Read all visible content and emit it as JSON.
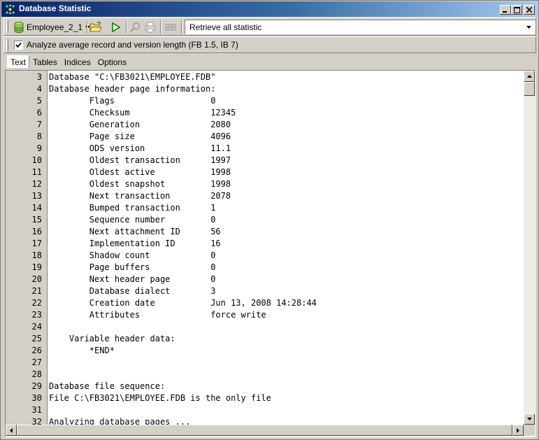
{
  "window": {
    "title": "Database Statistic",
    "controls": [
      "minimize",
      "maximize",
      "close"
    ]
  },
  "toolbar": {
    "database_label": "Employee_2_1",
    "buttons": [
      {
        "name": "open-folder",
        "icon": "folder-open-icon"
      },
      {
        "name": "run",
        "icon": "play-icon"
      },
      {
        "name": "find",
        "icon": "search-icon"
      },
      {
        "name": "print",
        "icon": "printer-icon"
      },
      {
        "name": "options",
        "icon": "grid-icon"
      }
    ],
    "mode": "Retrieve all statistic"
  },
  "options": {
    "analyze_checked": true,
    "analyze_label": "Analyze average record and version length (FB 1.5, IB 7)"
  },
  "tabs": [
    {
      "label": "Text",
      "active": true
    },
    {
      "label": "Tables",
      "active": false
    },
    {
      "label": "Indices",
      "active": false
    },
    {
      "label": "Options",
      "active": false
    }
  ],
  "editor": {
    "lines": [
      {
        "num": "3",
        "text": "Database \"C:\\FB3021\\EMPLOYEE.FDB\""
      },
      {
        "num": "4",
        "text": "Database header page information:"
      },
      {
        "num": "5",
        "text": "        Flags                   0"
      },
      {
        "num": "6",
        "text": "        Checksum                12345"
      },
      {
        "num": "7",
        "text": "        Generation              2080"
      },
      {
        "num": "8",
        "text": "        Page size               4096"
      },
      {
        "num": "9",
        "text": "        ODS version             11.1"
      },
      {
        "num": "10",
        "text": "        Oldest transaction      1997"
      },
      {
        "num": "11",
        "text": "        Oldest active           1998"
      },
      {
        "num": "12",
        "text": "        Oldest snapshot         1998"
      },
      {
        "num": "13",
        "text": "        Next transaction        2078"
      },
      {
        "num": "14",
        "text": "        Bumped transaction      1"
      },
      {
        "num": "15",
        "text": "        Sequence number         0"
      },
      {
        "num": "16",
        "text": "        Next attachment ID      56"
      },
      {
        "num": "17",
        "text": "        Implementation ID       16"
      },
      {
        "num": "18",
        "text": "        Shadow count            0"
      },
      {
        "num": "19",
        "text": "        Page buffers            0"
      },
      {
        "num": "20",
        "text": "        Next header page        0"
      },
      {
        "num": "21",
        "text": "        Database dialect        3"
      },
      {
        "num": "22",
        "text": "        Creation date           Jun 13, 2008 14:28:44"
      },
      {
        "num": "23",
        "text": "        Attributes              force write"
      },
      {
        "num": "24",
        "text": ""
      },
      {
        "num": "25",
        "text": "    Variable header data:"
      },
      {
        "num": "26",
        "text": "        *END*"
      },
      {
        "num": "27",
        "text": ""
      },
      {
        "num": "28",
        "text": ""
      },
      {
        "num": "29",
        "text": "Database file sequence:"
      },
      {
        "num": "30",
        "text": "File C:\\FB3021\\EMPLOYEE.FDB is the only file"
      },
      {
        "num": "31",
        "text": ""
      },
      {
        "num": "32",
        "text": "Analyzing database pages ..."
      }
    ]
  },
  "colors": {
    "titlebar_start": "#0a246a",
    "titlebar_end": "#a6caf0",
    "face": "#d4d0c8",
    "run_green": "#008000"
  }
}
